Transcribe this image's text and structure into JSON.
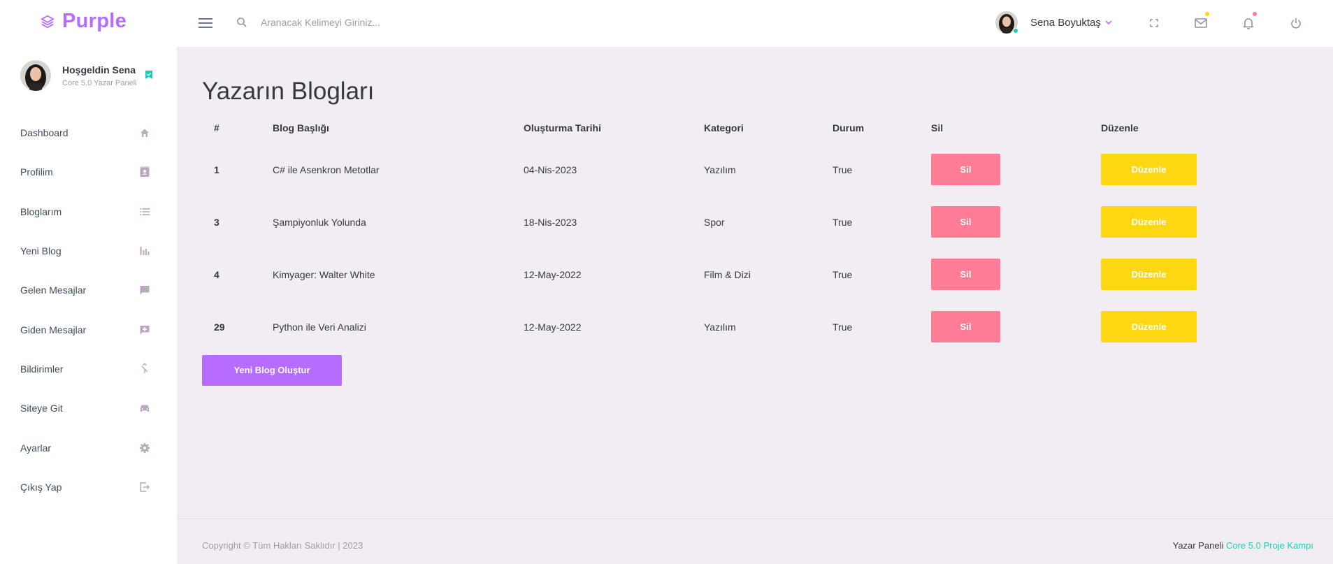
{
  "navbar": {
    "brand": "Purple",
    "search_placeholder": "Aranacak Kelimeyi Giriniz...",
    "user_name": "Sena Boyuktaş",
    "icons": [
      "menu-icon",
      "search-icon",
      "fullscreen-icon",
      "mail-icon",
      "bell-icon",
      "power-icon"
    ],
    "colors": {
      "mail_badge": "#fed713",
      "bell_badge": "#fe7c96",
      "online": "#1bcfb4"
    }
  },
  "sidebar": {
    "welcome": "Hoşgeldin Sena",
    "role": "Core 5.0 Yazar Paneli",
    "items": [
      {
        "label": "Dashboard",
        "icon": "home-icon"
      },
      {
        "label": "Profilim",
        "icon": "contact-card-icon"
      },
      {
        "label": "Bloglarım",
        "icon": "list-icon"
      },
      {
        "label": "Yeni Blog",
        "icon": "bar-chart-icon"
      },
      {
        "label": "Gelen Mesajlar",
        "icon": "message-icon"
      },
      {
        "label": "Giden Mesajlar",
        "icon": "message-plus-icon"
      },
      {
        "label": "Bildirimler",
        "icon": "merge-icon"
      },
      {
        "label": "Siteye Git",
        "icon": "car-icon"
      },
      {
        "label": "Ayarlar",
        "icon": "gear-icon"
      },
      {
        "label": "Çıkış Yap",
        "icon": "exit-icon"
      }
    ]
  },
  "main": {
    "title": "Yazarın Blogları",
    "columns": [
      "#",
      "Blog Başlığı",
      "Oluşturma Tarihi",
      "Kategori",
      "Durum",
      "Sil",
      "Düzenle"
    ],
    "rows": [
      {
        "id": "1",
        "title": "C# ile Asenkron Metotlar",
        "date": "04-Nis-2023",
        "category": "Yazılım",
        "status": "True",
        "delete": "Sil",
        "edit": "Düzenle"
      },
      {
        "id": "3",
        "title": "Şampiyonluk Yolunda",
        "date": "18-Nis-2023",
        "category": "Spor",
        "status": "True",
        "delete": "Sil",
        "edit": "Düzenle"
      },
      {
        "id": "4",
        "title": "Kimyager: Walter White",
        "date": "12-May-2022",
        "category": "Film & Dizi",
        "status": "True",
        "delete": "Sil",
        "edit": "Düzenle"
      },
      {
        "id": "29",
        "title": "Python ile Veri Analizi",
        "date": "12-May-2022",
        "category": "Yazılım",
        "status": "True",
        "delete": "Sil",
        "edit": "Düzenle"
      }
    ],
    "new_button": "Yeni Blog Oluştur",
    "colors": {
      "accent": "#b66dff",
      "delete": "#fe7c96",
      "edit": "#fed713"
    }
  },
  "footer": {
    "copyright": "Copyright © Tüm Hakları Saklıdır | 2023",
    "right_text": "Yazar Paneli",
    "right_link": "Core 5.0 Proje Kampı"
  }
}
